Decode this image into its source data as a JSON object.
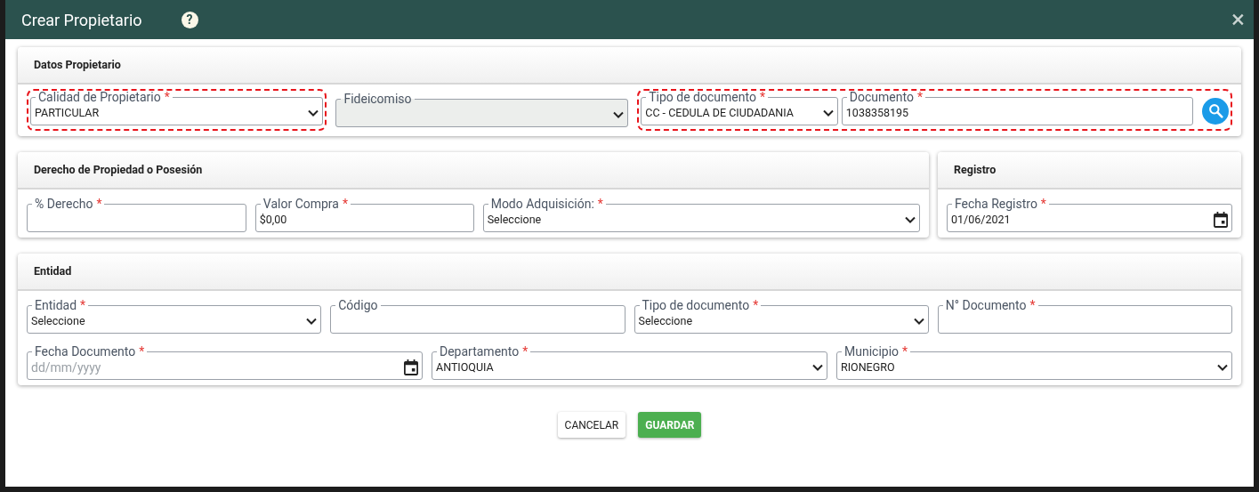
{
  "dialog": {
    "title": "Crear Propietario",
    "help": "?",
    "close": "×"
  },
  "panel_rows": [
    [
      {
        "title": "Datos Propietario",
        "rows": [
          [
            {
              "kind": "group",
              "highlighted": true,
              "items": [
                {
                  "kind": "select",
                  "label": "Calidad de Propietario",
                  "required_mark": "*",
                  "disabled": false,
                  "value": "PARTICULAR"
                }
              ]
            },
            {
              "kind": "select",
              "label": "Fideicomiso",
              "disabled": true
            },
            {
              "kind": "group",
              "highlighted": true,
              "items": [
                {
                  "kind": "select",
                  "label": "Tipo de documento",
                  "required_mark": "*",
                  "disabled": false,
                  "value": "CC - CEDULA DE CIUDADANIA"
                },
                {
                  "kind": "text",
                  "label": "Documento",
                  "required_mark": "*",
                  "disabled": false,
                  "value": "1038358195"
                },
                {
                  "kind": "search_button"
                }
              ]
            }
          ]
        ]
      }
    ],
    [
      {
        "title": "Derecho de Propiedad o Posesión",
        "rows": [
          [
            {
              "kind": "text",
              "label": "% Derecho",
              "required_mark": "*",
              "disabled": false
            },
            {
              "kind": "text",
              "label": "Valor Compra",
              "required_mark": "*",
              "disabled": false,
              "value": "$0,00"
            },
            {
              "kind": "select",
              "label": "Modo Adquisición:",
              "required_mark": "*",
              "disabled": false,
              "value": "Seleccione"
            }
          ]
        ]
      },
      {
        "title": "Registro",
        "rows": [
          [
            {
              "kind": "date",
              "label": "Fecha Registro",
              "required_mark": "*",
              "disabled": false,
              "value": "01/06/2021"
            }
          ]
        ]
      }
    ],
    [
      {
        "title": "Entidad",
        "rows": [
          [
            {
              "kind": "select",
              "label": "Entidad",
              "required_mark": "*",
              "disabled": false,
              "value": "Seleccione"
            },
            {
              "kind": "text",
              "label": "Código",
              "disabled": false
            },
            {
              "kind": "select",
              "label": "Tipo de documento",
              "required_mark": "*",
              "disabled": false,
              "value": "Seleccione"
            },
            {
              "kind": "text",
              "label": "N° Documento",
              "required_mark": "*",
              "disabled": false
            }
          ],
          [
            {
              "kind": "date",
              "label": "Fecha Documento",
              "required_mark": "*",
              "disabled": false,
              "placeholder": "dd/mm/yyyy"
            },
            {
              "kind": "select",
              "label": "Departamento",
              "required_mark": "*",
              "disabled": false,
              "value": "ANTIOQUIA"
            },
            {
              "kind": "select",
              "label": "Municipio",
              "required_mark": "*",
              "disabled": false,
              "value": "RIONEGRO"
            }
          ]
        ]
      }
    ]
  ],
  "buttons": [
    {
      "label": "CANCELAR",
      "kind": "secondary"
    },
    {
      "label": "GUARDAR",
      "kind": "primary"
    }
  ]
}
